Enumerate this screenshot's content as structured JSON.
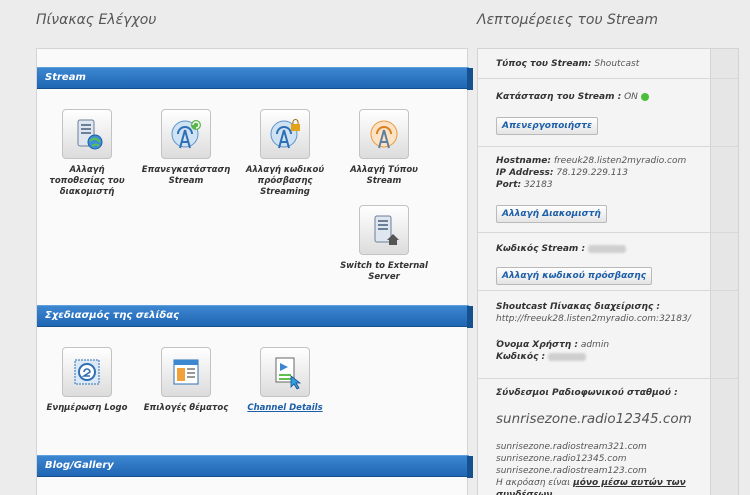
{
  "left_title": "Πίνακας Ελέγχου",
  "right_title": "Λεπτομέρειες του Stream",
  "sections": {
    "stream": "Stream",
    "design": "Σχεδιασμός της σελίδας",
    "blog": "Blog/Gallery"
  },
  "stream_items": {
    "change_location": "Αλλαγή τοποθεσίας του διακομιστή",
    "restart_stream": "Επανεγκατάσταση Stream",
    "change_password": "Αλλαγή κωδικού πρόσβασης Streaming",
    "change_type": "Αλλαγή Τύπου Stream",
    "switch_external": "Switch to External Server"
  },
  "design_items": {
    "update_logo": "Ενημέρωση Logo",
    "theme_options": "Επιλογές θέματος",
    "channel_details": "Channel Details"
  },
  "details": {
    "stream_type_label": "Τύπος του Stream:",
    "stream_type_value": "Shoutcast",
    "status_label": "Κατάσταση του Stream :",
    "status_value": "ON",
    "deactivate_button": "Απενεργοποιήστε",
    "hostname_label": "Hostname:",
    "hostname_value": "freeuk28.listen2myradio.com",
    "ip_label": "IP Address:",
    "ip_value": "78.129.229.113",
    "port_label": "Port:",
    "port_value": "32183",
    "change_server_button": "Αλλαγή Διακομιστή",
    "password_label": "Κωδικός Stream :",
    "change_password_button": "Αλλαγή κωδικού πρόσβασης",
    "admin_panel_label": "Shoutcast Πίνακας διαχείρισης :",
    "admin_url": "http://freeuk28.listen2myradio.com:32183/",
    "username_label": "Όνομα Χρήστη :",
    "username_value": "admin",
    "admin_password_label": "Κωδικός :",
    "links_label": "Σύνδεσμοι Ραδιοφωνικού σταθμού :",
    "primary_link": "sunrisezone.radio12345.com",
    "link_1": "sunrisezone.radiostream321.com",
    "link_2": "sunrisezone.radio12345.com",
    "link_3": "sunrisezone.radiostream123.com",
    "listen_note_prefix": "Η ακρόαση είναι",
    "listen_note_bold": "μόνο μέσω αυτών των συνδέσεων."
  },
  "colors": {
    "accent_blue": "#1f66b4",
    "link_blue": "#1d5fa8",
    "status_green": "#4cbf3a"
  }
}
